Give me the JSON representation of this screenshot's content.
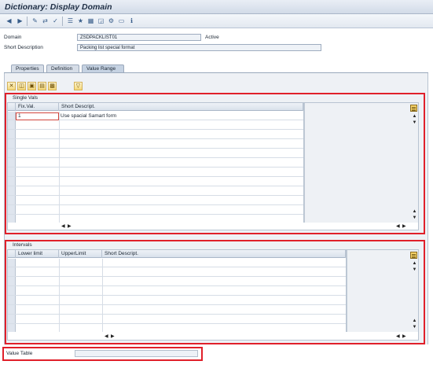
{
  "window": {
    "title": "Dictionary: Display Domain"
  },
  "toolbar": {
    "icons": [
      "back-arrow-icon",
      "forward-arrow-icon",
      "edit-icon",
      "other-object-icon",
      "check-icon",
      "activate-icon",
      "where-used-icon",
      "display-object-list-icon",
      "hierarchy-icon",
      "find-icon",
      "frame-icon",
      "info-icon"
    ]
  },
  "header": {
    "domain_label": "Domain",
    "domain_value": "ZSDPACKLIST01",
    "status": "Active",
    "short_desc_label": "Short Description",
    "short_desc_value": "Packing list special format"
  },
  "tabs": [
    {
      "label": "Properties"
    },
    {
      "label": "Definition"
    },
    {
      "label": "Value Range"
    }
  ],
  "active_tab": "Value Range",
  "single_vals": {
    "title": "Single Vals",
    "columns": [
      "Fix.Val.",
      "Short Descript."
    ],
    "rows": [
      {
        "fixval": "1",
        "desc": "Use spacial Samart form"
      }
    ]
  },
  "intervals": {
    "title": "Intervals",
    "columns": [
      "Lower limit",
      "UpperLimit",
      "Short Descript."
    ]
  },
  "value_table": {
    "label": "Value Table",
    "value": ""
  },
  "colors": {
    "highlight_box": "#e0202a"
  }
}
